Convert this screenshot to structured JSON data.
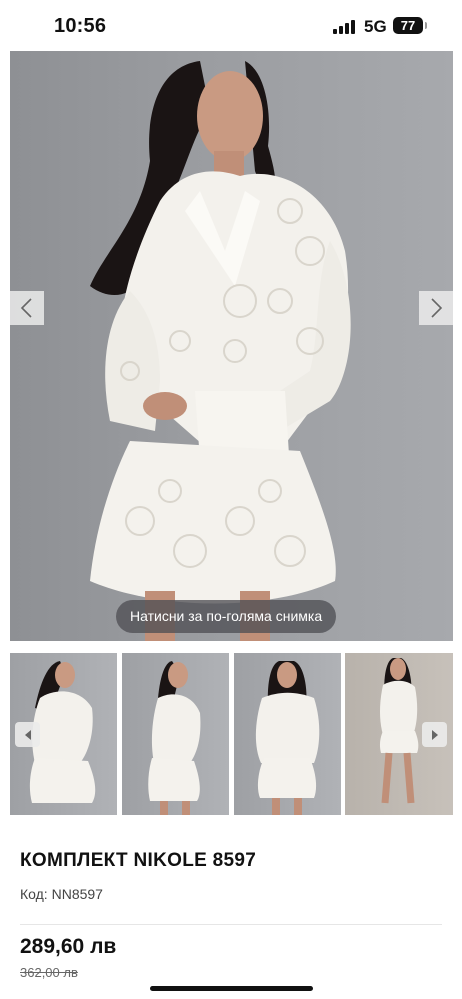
{
  "status_bar": {
    "time": "10:56",
    "network": "5G",
    "battery": "77"
  },
  "gallery": {
    "zoom_hint": "Натисни за по-голяма снимка",
    "prev_icon": "chevron-left-icon",
    "next_icon": "chevron-right-icon",
    "thumbnail_count": 4
  },
  "product": {
    "title": "КОМПЛЕКТ NIKOLE 8597",
    "code_label": "Код:",
    "code_value": "NN8597",
    "price": "289,60 лв",
    "old_price": "362,00 лв"
  },
  "colors": {
    "photo_background": "#9a9ca0",
    "outfit": "#f3f1ec",
    "text": "#111111"
  }
}
